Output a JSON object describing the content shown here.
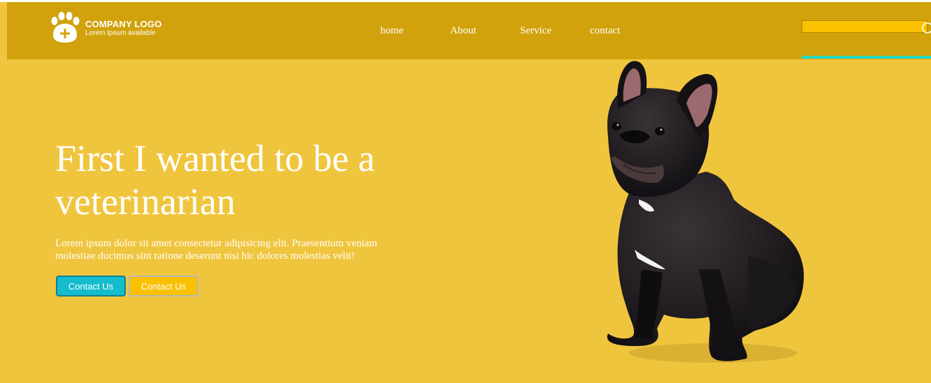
{
  "brand": {
    "title": "COMPANY LOGO",
    "subtitle": "Lorem Ipsum available",
    "icon": "paw-plus-icon"
  },
  "nav": {
    "items": [
      "home",
      "About",
      "Service",
      "contact"
    ]
  },
  "search": {
    "value": "",
    "placeholder": "",
    "icon": "search-icon"
  },
  "hero": {
    "title": "First I wanted to be a veterinarian",
    "text": "Lorem ipsum dolor sit amet consectetur adipisicing elit. Praesentium veniam molestiae ducimus sint ratione deserunt nisi hic dolores molestias velit!",
    "primary_button": "Contact Us",
    "secondary_button": "Contact Us",
    "image": "french-bulldog-image"
  },
  "colors": {
    "header": "#d1a20c",
    "background": "#f0c53e",
    "accent": "#23d9c4",
    "primary_button": "#14bccd",
    "secondary_button": "#f9c100"
  }
}
